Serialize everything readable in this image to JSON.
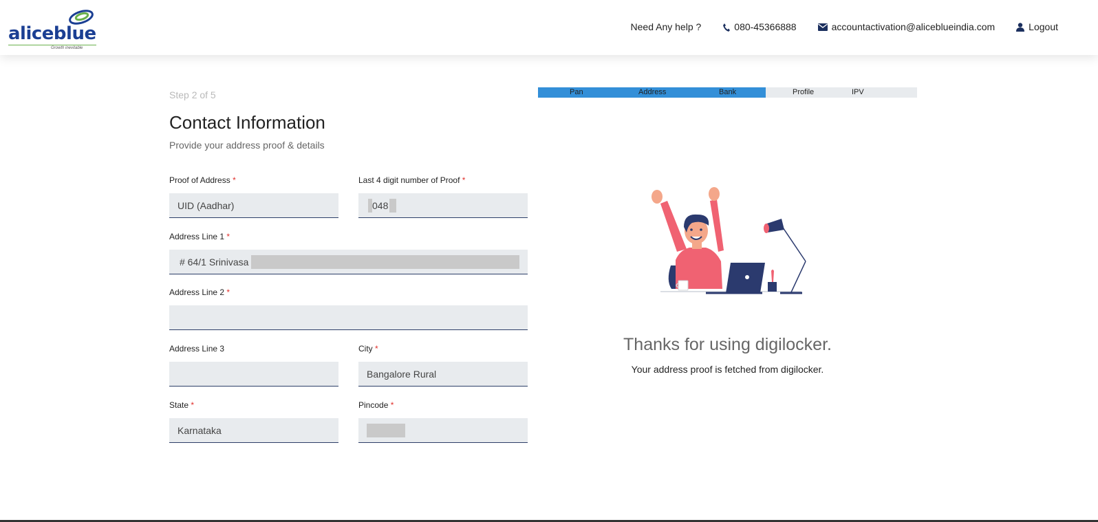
{
  "brand": {
    "name": "aliceblue",
    "tagline": "Growth inevitable",
    "colors": {
      "primary": "#1b3f93",
      "accent": "#6ab04c",
      "progress": "#338fd8"
    }
  },
  "header": {
    "help_text": "Need Any help ?",
    "phone": "080-45366888",
    "email": "accountactivation@aliceblueindia.com",
    "logout": "Logout",
    "icons": [
      "phone-icon",
      "envelope-icon",
      "user-icon"
    ]
  },
  "form": {
    "step": "Step 2 of 5",
    "title": "Contact Information",
    "subtitle": "Provide your address proof & details",
    "fields": {
      "proof_of_address": {
        "label": "Proof of Address",
        "value": "UID (Aadhar)"
      },
      "last4": {
        "label": "Last 4 digit number of Proof",
        "value": "048"
      },
      "address1": {
        "label": "Address Line 1",
        "value": "# 64/1 Srinivasa"
      },
      "address2": {
        "label": "Address Line 2",
        "value": ""
      },
      "address3": {
        "label": "Address Line 3",
        "value": ""
      },
      "city": {
        "label": "City",
        "value": "Bangalore Rural"
      },
      "state": {
        "label": "State",
        "value": "Karnataka"
      },
      "pincode": {
        "label": "Pincode",
        "value": ""
      }
    },
    "required_mark": "*"
  },
  "progress": {
    "steps": [
      "Pan",
      "Address",
      "Bank",
      "Profile",
      "IPV"
    ],
    "completed_fraction": 0.6
  },
  "panel": {
    "thanks_title": "Thanks for using digilocker.",
    "thanks_sub": "Your address proof is fetched from digilocker."
  }
}
